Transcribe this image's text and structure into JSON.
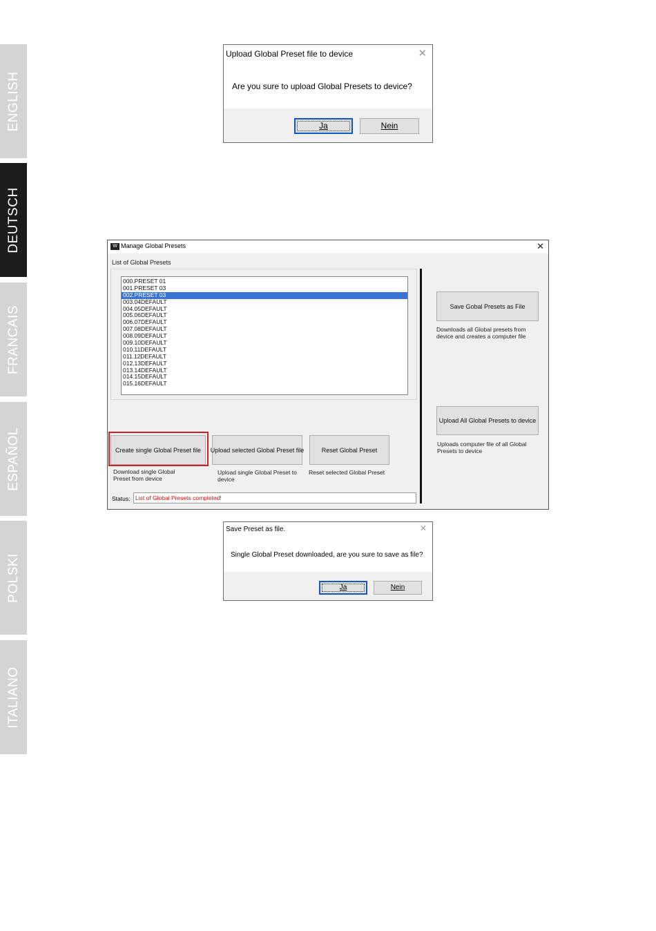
{
  "language_tabs": [
    {
      "label": "ENGLISH",
      "active": false
    },
    {
      "label": "DEUTSCH",
      "active": true
    },
    {
      "label": "FRANCAIS",
      "active": false
    },
    {
      "label": "ESPAÑOL",
      "active": false
    },
    {
      "label": "POLSKI",
      "active": false
    },
    {
      "label": "ITALIANO",
      "active": false
    }
  ],
  "upload_dialog": {
    "title": "Upload Global Preset file to device",
    "message": "Are you sure to upload Global Presets to device?",
    "yes_label": "Ja",
    "no_label": "Nein"
  },
  "manage_window": {
    "icon_label": "W",
    "title": "Manage Global Presets",
    "list_label": "List of Global Presets",
    "presets": [
      "000.PRESET 01",
      "001.PRESET 03",
      "002.PRESET 03",
      "003.04DEFAULT",
      "004.05DEFAULT",
      "005.06DEFAULT",
      "006.07DEFAULT",
      "007.08DEFAULT",
      "008.09DEFAULT",
      "009.10DEFAULT",
      "010.11DEFAULT",
      "011.12DEFAULT",
      "012.13DEFAULT",
      "013.14DEFAULT",
      "014.15DEFAULT",
      "015.16DEFAULT"
    ],
    "selected_index": 2,
    "buttons": {
      "create_single": "Create single Global Preset file",
      "upload_selected": "Upload selected Global Preset file",
      "reset": "Reset Global Preset",
      "save_all": "Save Gobal Presets as File",
      "upload_all": "Upload All Global Presets to device"
    },
    "descriptions": {
      "create_single": "Download single Global Preset from device",
      "upload_selected": "Upload single Global Preset to device",
      "reset": "Reset selected Global Preset",
      "save_all": "Downloads all Global presets from device and creates a computer file",
      "upload_all": "Uploads computer file of all Global Presets to device"
    },
    "status_label": "Status:",
    "status_text": "List of Global Presets completed!",
    "colors": {
      "highlight": "#d0231f",
      "selection": "#3874d8",
      "status_text": "#cc1010"
    }
  },
  "save_dialog": {
    "title": "Save Preset as file.",
    "message": "Single Global Preset downloaded, are you sure to save as file?",
    "yes_label": "Ja",
    "no_label": "Nein"
  }
}
